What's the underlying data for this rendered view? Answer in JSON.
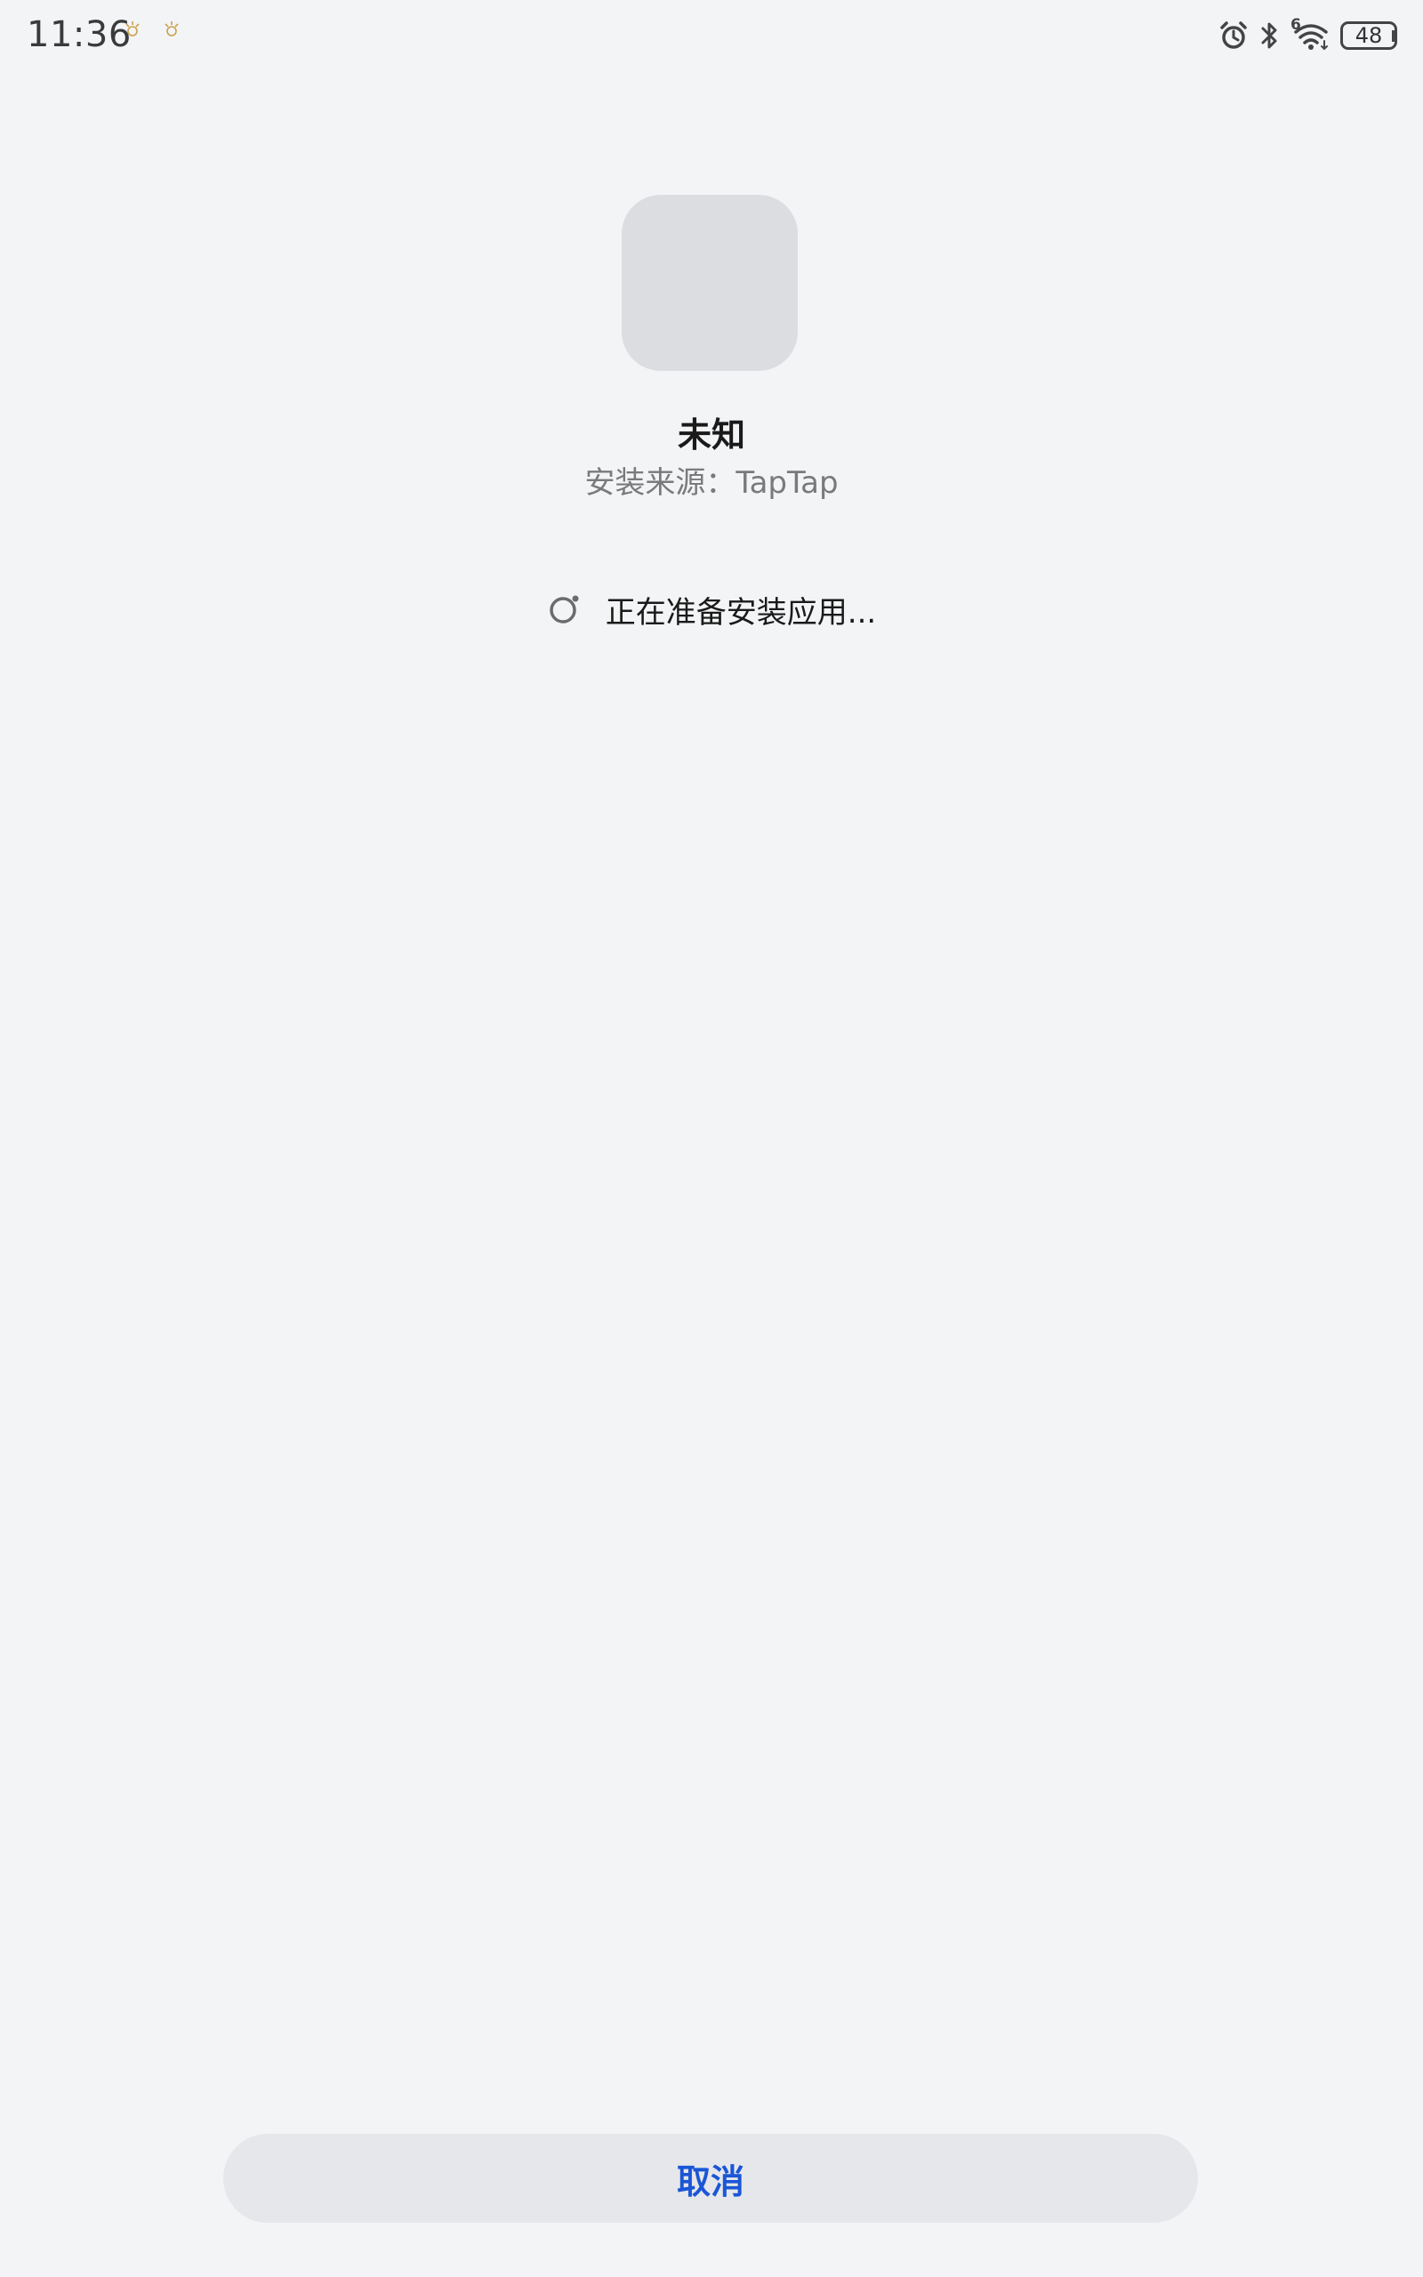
{
  "status_bar": {
    "time": "11:36",
    "notification_icons": [
      "notification-icon",
      "notification-icon"
    ],
    "icons": [
      "alarm-icon",
      "bluetooth-icon",
      "wifi-icon",
      "battery-icon"
    ],
    "wifi_badge": "6",
    "battery_level": "48"
  },
  "app": {
    "name": "未知",
    "install_source": "安装来源：TapTap"
  },
  "progress": {
    "text": "正在准备安装应用..."
  },
  "actions": {
    "cancel_label": "取消",
    "cancel_color": "#1a56d6"
  }
}
